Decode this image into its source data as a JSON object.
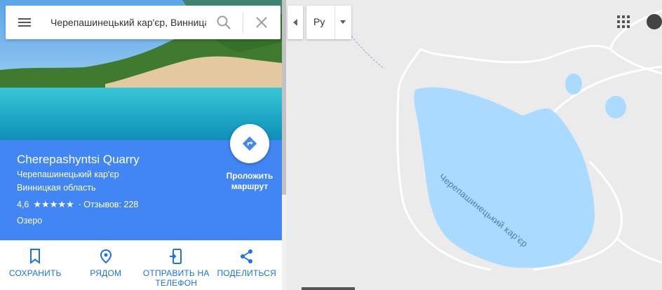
{
  "search": {
    "value": "Черепашинецький кар'єр, Винница"
  },
  "place": {
    "title": "Cherepashyntsi Quarry",
    "local_name": "Черепашинецький кар'єр",
    "region": "Винницкая область",
    "rating": "4,6",
    "stars": "★★★★★",
    "reviews": "· Отзывов: 228",
    "category": "Озеро"
  },
  "route": {
    "label_line1": "Проложить",
    "label_line2": "маршрут"
  },
  "actions": [
    {
      "label": "СОХРАНИТЬ",
      "icon": "bookmark-icon"
    },
    {
      "label": "РЯДОМ",
      "icon": "nearby-pin-icon"
    },
    {
      "label": "ОТПРАВИТЬ НА ТЕЛЕФОН",
      "icon": "send-to-phone-icon"
    },
    {
      "label": "ПОДЕЛИТЬСЯ",
      "icon": "share-icon"
    }
  ],
  "language": {
    "value": "Ру"
  },
  "map": {
    "lake_label": "Черепашинецький кар'єр"
  },
  "colors": {
    "accent": "#4285f4",
    "action": "#1a73e8",
    "water": "#aadaff",
    "pin": "#ea4335"
  }
}
